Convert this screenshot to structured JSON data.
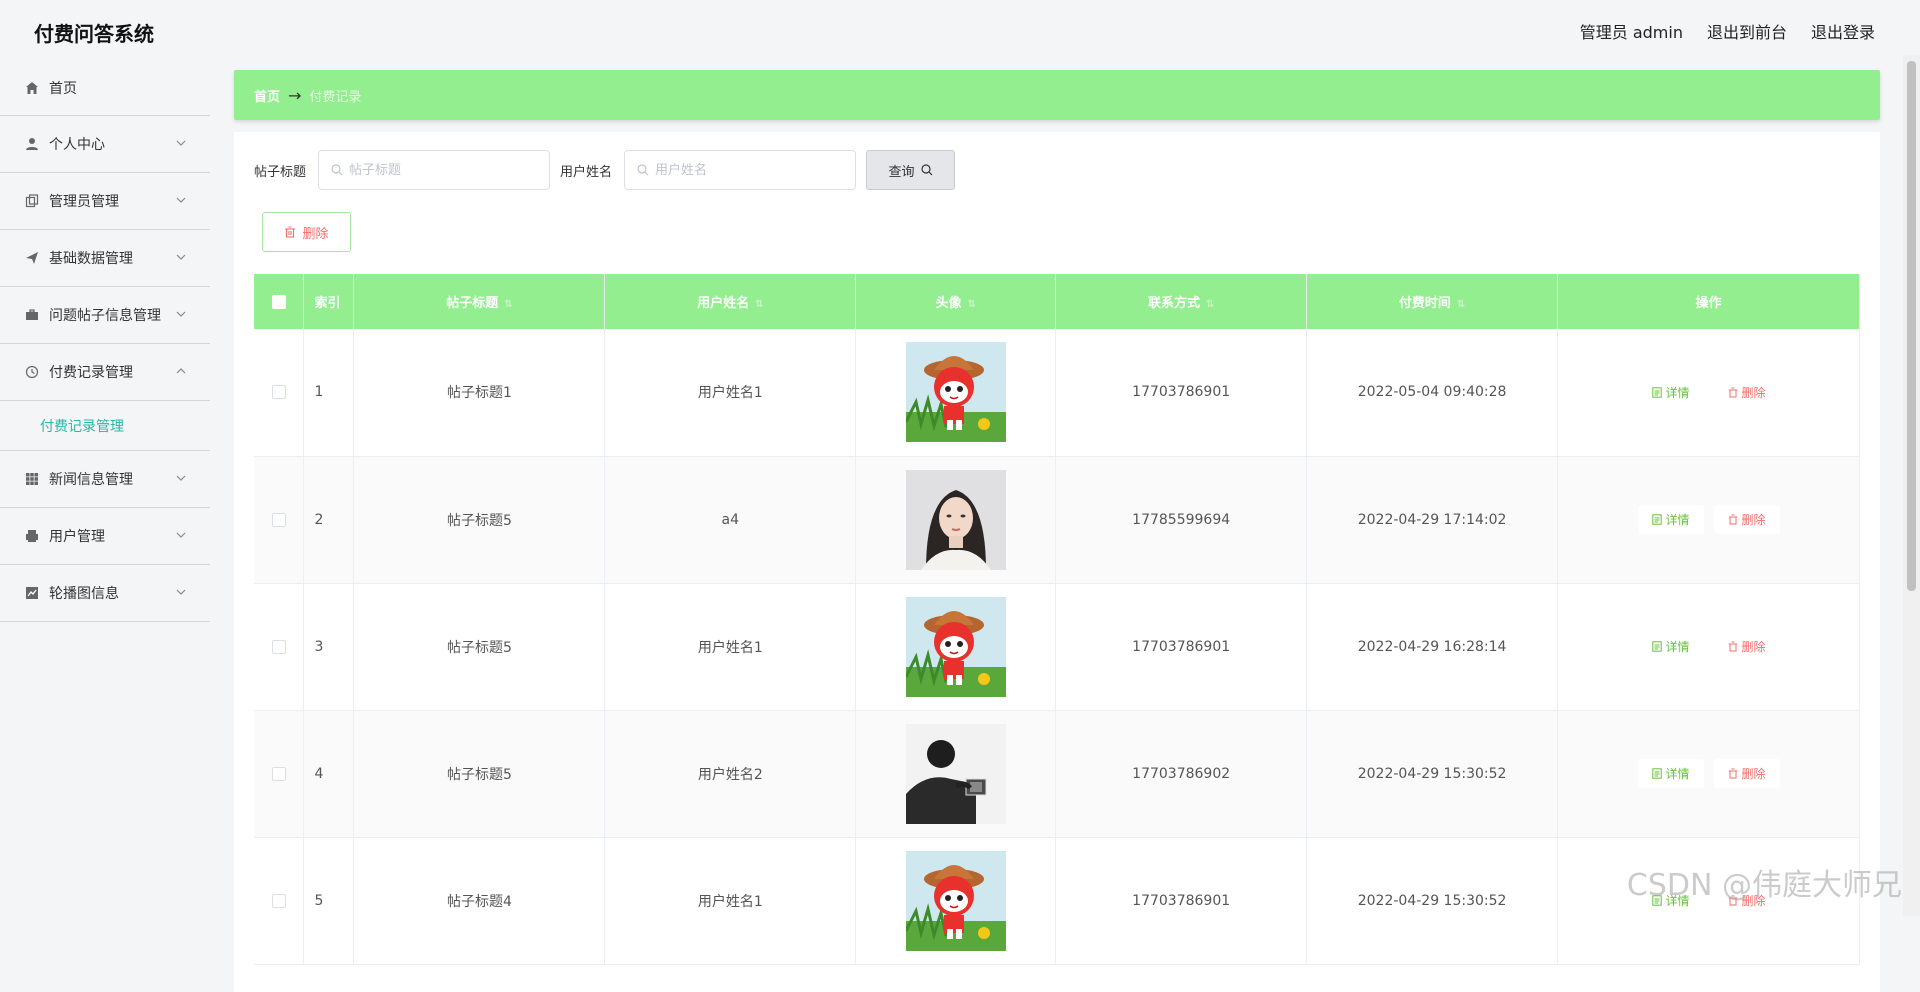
{
  "app": {
    "title": "付费问答系统"
  },
  "top_links": {
    "user": "管理员 admin",
    "frontend": "退出到前台",
    "logout": "退出登录"
  },
  "sidebar": {
    "items": [
      {
        "label": "首页",
        "icon": "home-icon"
      },
      {
        "label": "个人中心",
        "icon": "user-icon"
      },
      {
        "label": "管理员管理",
        "icon": "copy-icon"
      },
      {
        "label": "基础数据管理",
        "icon": "send-icon"
      },
      {
        "label": "问题帖子信息管理",
        "icon": "briefcase-icon"
      },
      {
        "label": "付费记录管理",
        "icon": "clock-icon"
      },
      {
        "label": "新闻信息管理",
        "icon": "grid-icon"
      },
      {
        "label": "用户管理",
        "icon": "printer-icon"
      },
      {
        "label": "轮播图信息",
        "icon": "chart-icon"
      }
    ],
    "active_sub": "付费记录管理"
  },
  "breadcrumb": {
    "home": "首页",
    "current": "付费记录"
  },
  "search": {
    "title_label": "帖子标题",
    "title_placeholder": "帖子标题",
    "user_label": "用户姓名",
    "user_placeholder": "用户姓名",
    "query_label": "查询"
  },
  "actions": {
    "delete_label": "删除"
  },
  "table": {
    "headers": [
      "索引",
      "帖子标题",
      "用户姓名",
      "头像",
      "联系方式",
      "付费时间",
      "操作"
    ],
    "rows": [
      {
        "index": "1",
        "title": "帖子标题1",
        "user": "用户姓名1",
        "avatar": "cartoon",
        "phone": "17703786901",
        "time": "2022-05-04 09:40:28"
      },
      {
        "index": "2",
        "title": "帖子标题5",
        "user": "a4",
        "avatar": "woman",
        "phone": "17785599694",
        "time": "2022-04-29 17:14:02"
      },
      {
        "index": "3",
        "title": "帖子标题5",
        "user": "用户姓名1",
        "avatar": "cartoon",
        "phone": "17703786901",
        "time": "2022-04-29 16:28:14"
      },
      {
        "index": "4",
        "title": "帖子标题5",
        "user": "用户姓名2",
        "avatar": "man",
        "phone": "17703786902",
        "time": "2022-04-29 15:30:52"
      },
      {
        "index": "5",
        "title": "帖子标题4",
        "user": "用户姓名1",
        "avatar": "cartoon",
        "phone": "17703786901",
        "time": "2022-04-29 15:30:52"
      }
    ],
    "detail_label": "详情",
    "delete_label": "删除"
  },
  "watermark": "CSDN @伟庭大师兄",
  "colors": {
    "accent": "#93ee8f",
    "active_text": "#27b8a4",
    "danger": "#f56c6c",
    "success": "#67c23a"
  }
}
